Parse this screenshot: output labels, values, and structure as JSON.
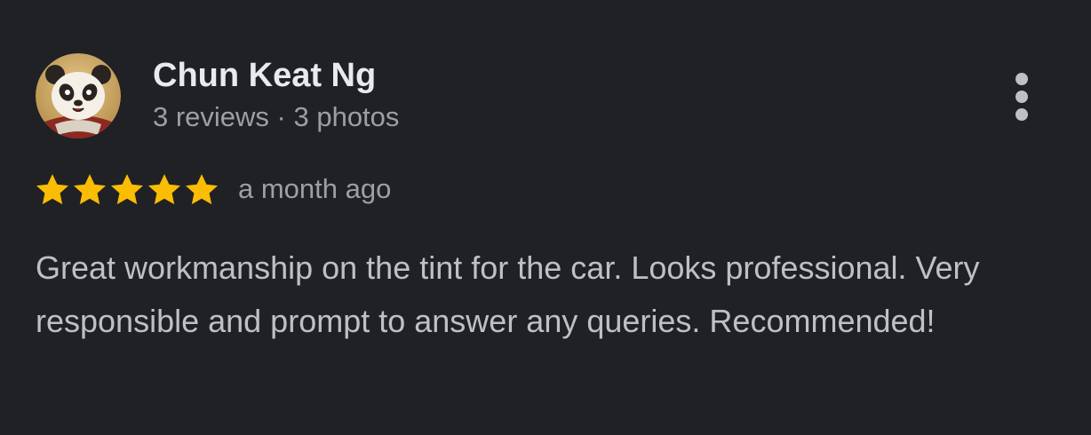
{
  "review": {
    "author": {
      "name": "Chun Keat Ng",
      "meta": "3 reviews · 3 photos",
      "avatar_icon": "panda-avatar-icon"
    },
    "rating": {
      "stars": 5,
      "max": 5,
      "star_color": "#fbbc04",
      "icon": "star-icon"
    },
    "date": "a month ago",
    "text": "Great workmanship on the tint for the car. Looks professional. Very responsible and prompt to answer any queries. Recommended!",
    "menu_icon": "more-vertical-icon"
  },
  "colors": {
    "background": "#202124",
    "name_text": "#e8eaed",
    "secondary_text": "#9aa0a6",
    "body_text": "#bdc1c6"
  }
}
